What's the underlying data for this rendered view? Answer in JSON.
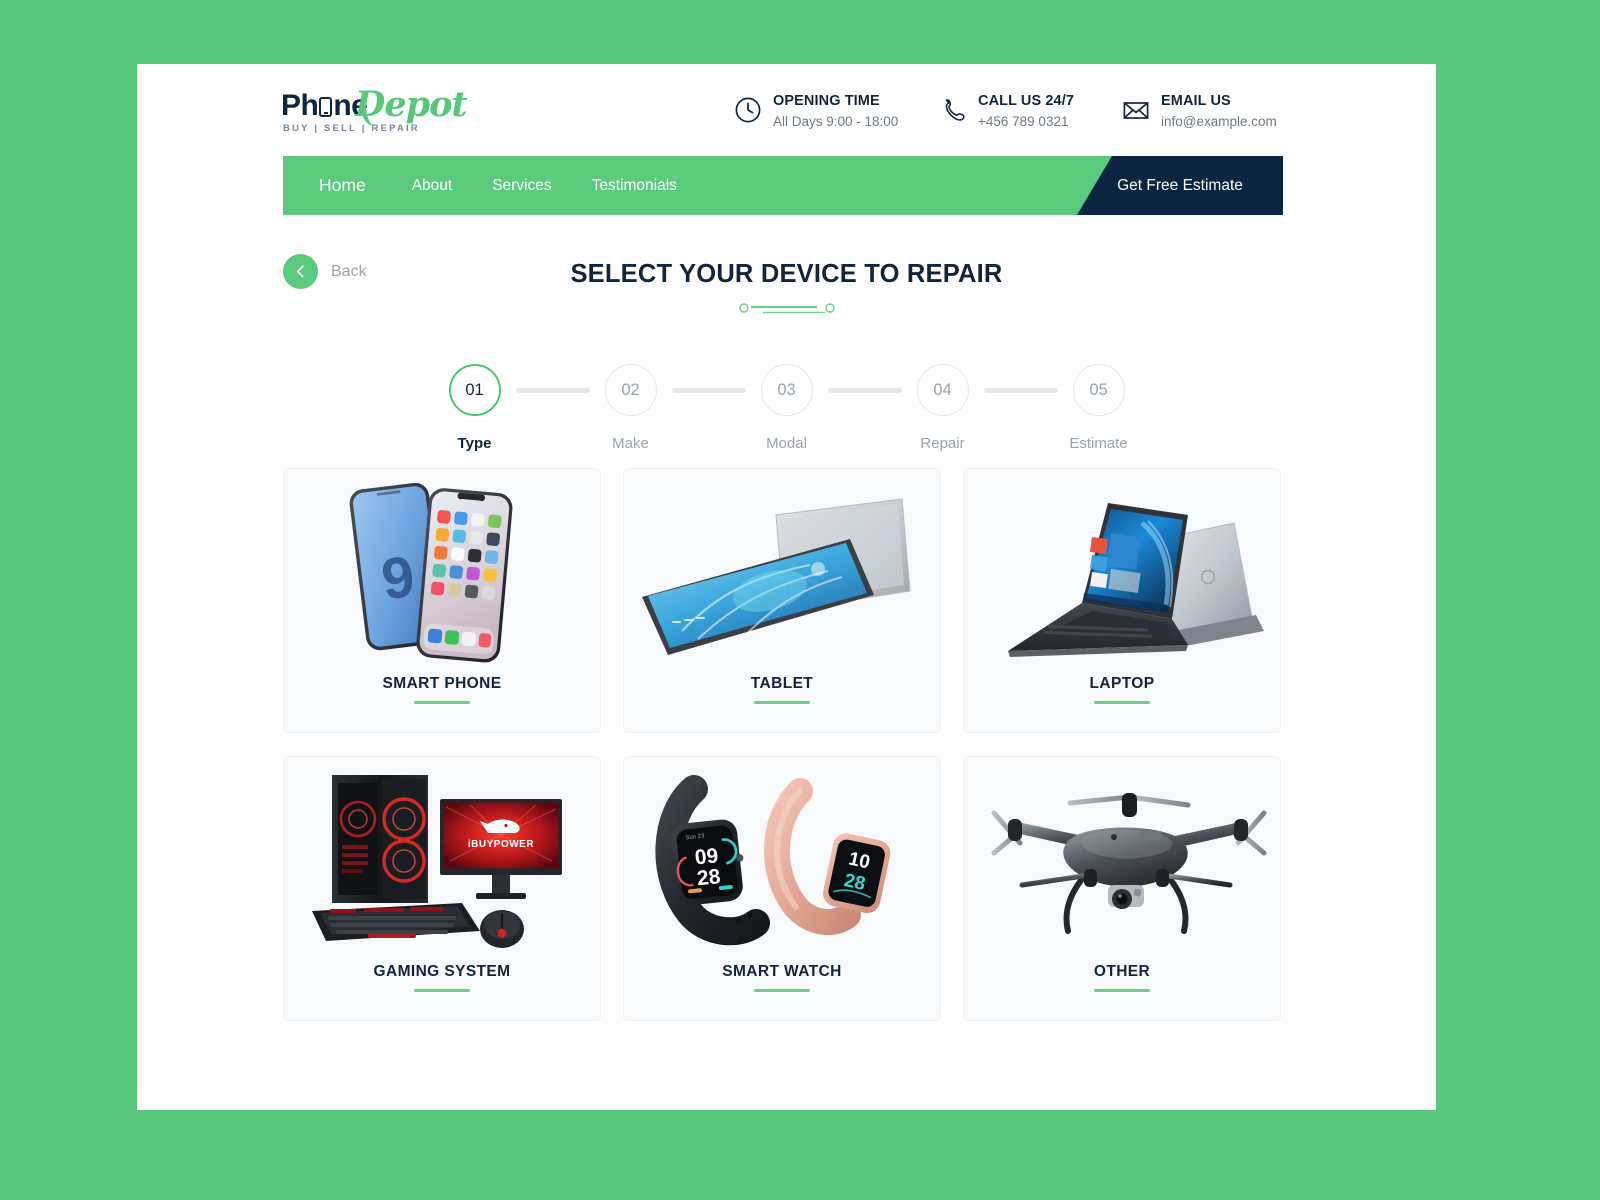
{
  "theme": {
    "page_background": "#58c87f",
    "sheet_background": "#ffffff",
    "brand_green": "#5bc97e",
    "brand_navy": "#0a2540",
    "accent_underline": "#6bd089",
    "card_background": "#f7f9fb",
    "muted_text": "#9aa3ad"
  },
  "header": {
    "logo": {
      "text_primary": "Ph",
      "text_primary_tail": "ne",
      "text_secondary": "Depot",
      "tagline": "BUY | SELL | REPAIR",
      "phone_icon_name": "phone-letter-o-icon"
    },
    "contacts": [
      {
        "icon": "clock-icon",
        "title": "OPENING TIME",
        "value": "All Days 9:00 - 18:00"
      },
      {
        "icon": "phone-handset-icon",
        "title": "CALL US 24/7",
        "value": "+456 789 0321"
      },
      {
        "icon": "envelope-icon",
        "title": "EMAIL US",
        "value": "info@example.com"
      }
    ]
  },
  "nav": {
    "items": [
      {
        "label": "Home",
        "active": true
      },
      {
        "label": "About",
        "active": false
      },
      {
        "label": "Services",
        "active": false
      },
      {
        "label": "Testimonials",
        "active": false
      }
    ],
    "cta_label": "Get Free Estimate"
  },
  "wizard": {
    "back_label": "Back",
    "back_icon": "chevron-left-icon",
    "title": "SELECT YOUR DEVICE TO REPAIR",
    "steps": [
      {
        "number": "01",
        "label": "Type",
        "active": true
      },
      {
        "number": "02",
        "label": "Make",
        "active": false
      },
      {
        "number": "03",
        "label": "Modal",
        "active": false
      },
      {
        "number": "04",
        "label": "Repair",
        "active": false
      },
      {
        "number": "05",
        "label": "Estimate",
        "active": false
      }
    ]
  },
  "devices": [
    {
      "label": "SMART PHONE",
      "art": "smartphone-pair-image",
      "watch_time_black": "",
      "watch_time_rose": ""
    },
    {
      "label": "TABLET",
      "art": "tablet-pair-image"
    },
    {
      "label": "LAPTOP",
      "art": "laptop-pair-image"
    },
    {
      "label": "GAMING SYSTEM",
      "art": "gaming-desktop-image",
      "monitor_brand": "iBUYPOWER"
    },
    {
      "label": "SMART  WATCH",
      "art": "smartwatch-pair-image",
      "watch_time_black": "09 28",
      "watch_time_rose": "10 28"
    },
    {
      "label": "OTHER",
      "art": "drone-image"
    }
  ],
  "device_art_detail": {
    "smartphone_galaxy_digit": "9",
    "watch_black_hour": "09",
    "watch_black_minute": "28",
    "watch_rose_hour": "10",
    "watch_rose_minute": "28",
    "gaming_monitor_logo": "iBUYPOWER"
  }
}
